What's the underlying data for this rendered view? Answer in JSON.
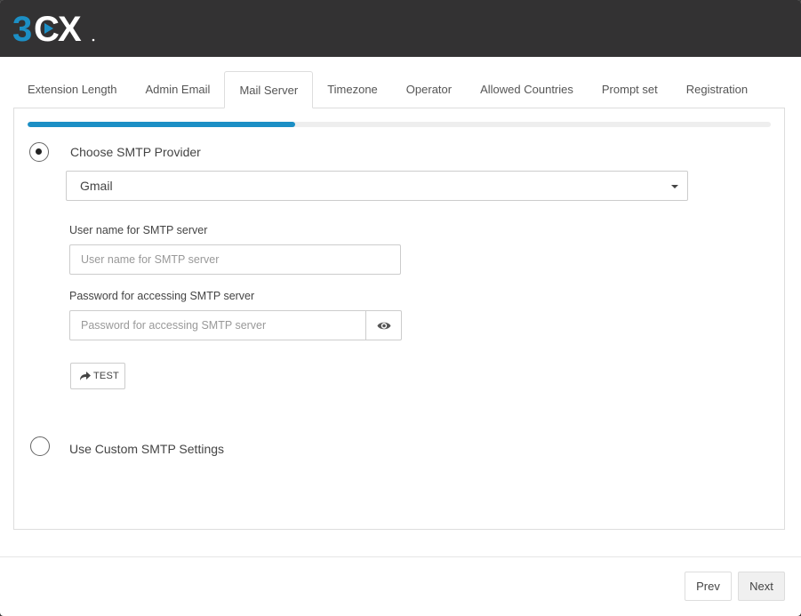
{
  "header": {
    "logo_text": "3CX",
    "background_color": "#333233",
    "brand_color": "#1c8fc5"
  },
  "tabs": [
    {
      "label": "Extension Length",
      "active": false
    },
    {
      "label": "Admin Email",
      "active": false
    },
    {
      "label": "Mail Server",
      "active": true
    },
    {
      "label": "Timezone",
      "active": false
    },
    {
      "label": "Operator",
      "active": false
    },
    {
      "label": "Allowed Countries",
      "active": false
    },
    {
      "label": "Prompt set",
      "active": false
    },
    {
      "label": "Registration",
      "active": false
    }
  ],
  "progress": {
    "fraction": 0.36,
    "color": "#1c8fc5"
  },
  "smtp_provider": {
    "label": "Choose SMTP Provider",
    "selected": true,
    "provider_value": "Gmail",
    "username": {
      "label": "User name for SMTP server",
      "value": "",
      "placeholder": "User name for SMTP server"
    },
    "password": {
      "label": "Password for accessing SMTP server",
      "value": "",
      "placeholder": "Password for accessing SMTP server",
      "toggle_icon": "eye-icon"
    },
    "test_button": {
      "label": "TEST",
      "icon": "share-arrow-icon"
    }
  },
  "custom_smtp": {
    "label": "Use Custom SMTP Settings",
    "selected": false
  },
  "footer": {
    "prev_label": "Prev",
    "next_label": "Next"
  }
}
